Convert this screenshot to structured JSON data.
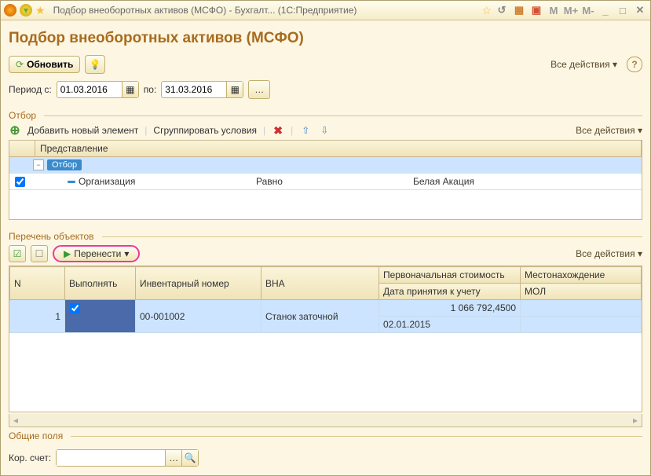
{
  "titlebar": {
    "title": "Подбор внеоборотных активов (МСФО) - Бухгалт... (1С:Предприятие)",
    "m_buttons": [
      "M",
      "M+",
      "M-"
    ]
  },
  "page": {
    "heading": "Подбор внеоборотных активов (МСФО)"
  },
  "toolbar": {
    "refresh": "Обновить",
    "all_actions": "Все действия"
  },
  "period": {
    "label_from": "Период с:",
    "from": "01.03.2016",
    "label_to": "по:",
    "to": "31.03.2016"
  },
  "sections": {
    "filter": "Отбор",
    "objects": "Перечень объектов",
    "common": "Общие поля"
  },
  "filter_toolbar": {
    "add": "Добавить новый элемент",
    "group": "Сгруппировать условия",
    "all_actions": "Все действия"
  },
  "filter_grid": {
    "col_rep": "Представление",
    "row_otbor": "Отбор",
    "row_org": {
      "field": "Организация",
      "op": "Равно",
      "value": "Белая Акация"
    }
  },
  "objects_toolbar": {
    "transfer": "Перенести",
    "all_actions": "Все действия"
  },
  "objects_grid": {
    "cols": {
      "n": "N",
      "exec": "Выполнять",
      "inv": "Инвентарный номер",
      "vna": "ВНА",
      "cost": "Первоначальная стоимость",
      "loc": "Местонахождение",
      "date": "Дата принятия к учету",
      "mol": "МОЛ"
    },
    "row": {
      "n": "1",
      "inv": "00-001002",
      "vna": "Станок заточной",
      "cost": "1 066 792,4500",
      "date": "02.01.2015"
    }
  },
  "common": {
    "kor_label": "Кор. счет:"
  }
}
